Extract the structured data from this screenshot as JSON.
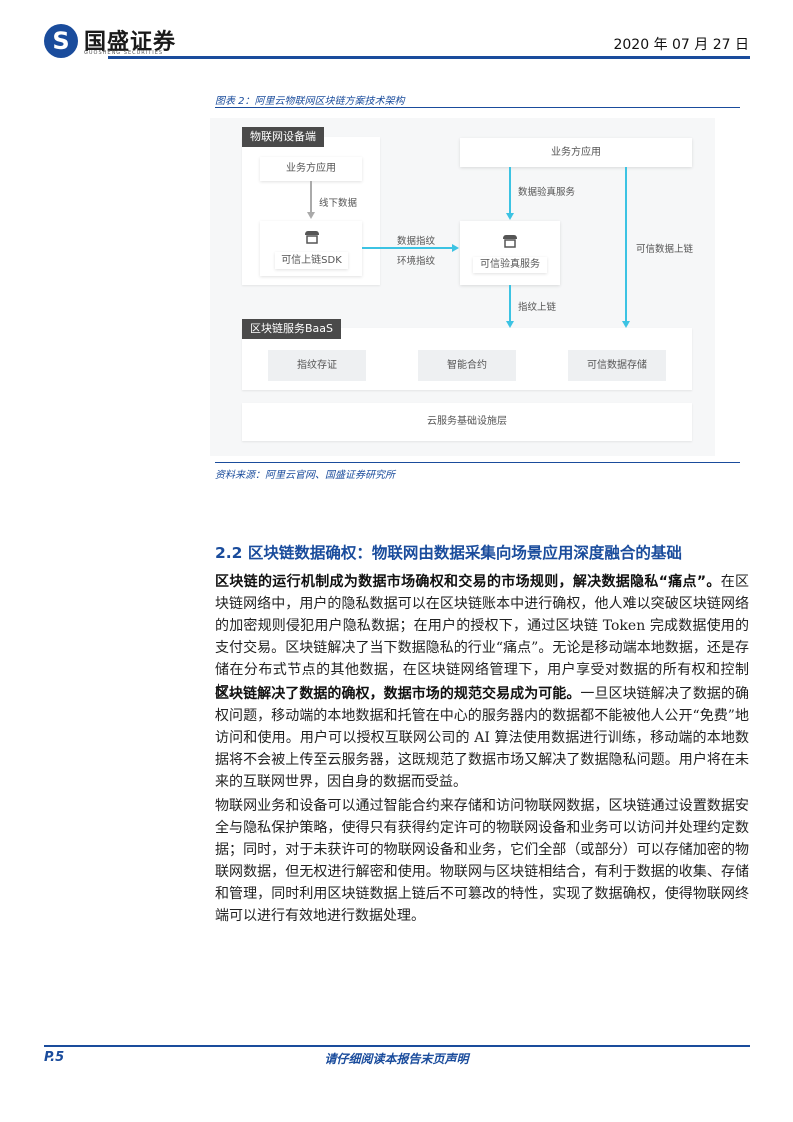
{
  "header": {
    "logo_cn": "国盛证券",
    "logo_en": "GUOSHENG SECURITIES",
    "date": "2020 年 07 月 27 日"
  },
  "figure": {
    "caption": "图表 2：阿里云物联网区块链方案技术架构",
    "device_side": "物联网设备端",
    "biz_app_left": "业务方应用",
    "offline_data": "线下数据",
    "sdk": "可信上链SDK",
    "data_fingerprint": "数据指纹",
    "env_fingerprint": "环境指纹",
    "verify_service": "可信验真服务",
    "biz_app_right": "业务方应用",
    "data_verify": "数据验真服务",
    "trusted_upload": "可信数据上链",
    "fingerprint_upload": "指纹上链",
    "baas": "区块链服务BaaS",
    "baas_items": [
      "指纹存证",
      "智能合约",
      "可信数据存储"
    ],
    "cloud": "云服务基础设施层",
    "source": "资料来源：阿里云官网、国盛证券研究所"
  },
  "section": {
    "title": "2.2 区块链数据确权：物联网由数据采集向场景应用深度融合的基础"
  },
  "paragraphs": [
    {
      "bold": "区块链的运行机制成为数据市场确权和交易的市场规则，解决数据隐私“痛点”。",
      "text": "在区块链网络中，用户的隐私数据可以在区块链账本中进行确权，他人难以突破区块链网络的加密规则侵犯用户隐私数据；在用户的授权下，通过区块链 Token 完成数据使用的支付交易。区块链解决了当下数据隐私的行业“痛点”。无论是移动端本地数据，还是存储在分布式节点的其他数据，在区块链网络管理下，用户享受对数据的所有权和控制权。"
    },
    {
      "bold": "区块链解决了数据的确权，数据市场的规范交易成为可能。",
      "text": "一旦区块链解决了数据的确权问题，移动端的本地数据和托管在中心的服务器内的数据都不能被他人公开“免费”地访问和使用。用户可以授权互联网公司的 AI 算法使用数据进行训练，移动端的本地数据将不会被上传至云服务器，这既规范了数据市场又解决了数据隐私问题。用户将在未来的互联网世界，因自身的数据而受益。"
    },
    {
      "bold": "",
      "text": "物联网业务和设备可以通过智能合约来存储和访问物联网数据，区块链通过设置数据安全与隐私保护策略，使得只有获得约定许可的物联网设备和业务可以访问并处理约定数据；同时，对于未获许可的物联网设备和业务，它们全部（或部分）可以存储加密的物联网数据，但无权进行解密和使用。物联网与区块链相结合，有利于数据的收集、存储和管理，同时利用区块链数据上链后不可篡改的特性，实现了数据确权，使得物联网终端可以进行有效地进行数据处理。"
    }
  ],
  "footer": {
    "page": "P.5",
    "note": "请仔细阅读本报告末页声明"
  }
}
